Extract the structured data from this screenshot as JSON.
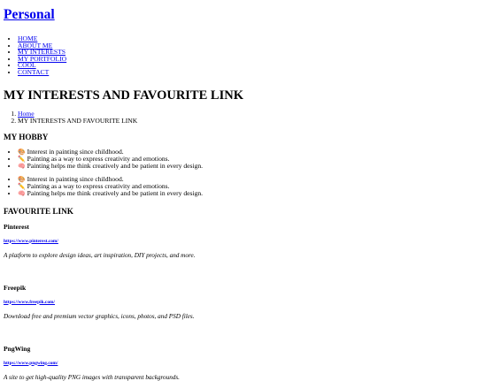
{
  "site": {
    "title": "Personal"
  },
  "nav": {
    "items": [
      "HOME",
      "ABOUT ME",
      "MY INTERESTS",
      "MY PORTFOLIO",
      "COOL",
      "CONTACT"
    ]
  },
  "page": {
    "title": "MY INTERESTS AND FAVOURITE LINK"
  },
  "breadcrumb": {
    "items": [
      "Home",
      "MY INTERESTS AND FAVOURITE LINK"
    ]
  },
  "hobby": {
    "title": "MY HOBBY",
    "list1": [
      {
        "icon": "🎨",
        "text": "Interest in painting since childhood."
      },
      {
        "icon": "✏️",
        "text": "Painting as a way to express creativity and emotions."
      },
      {
        "icon": "🧠",
        "text": "Painting helps me think creatively and be patient in every design."
      }
    ],
    "list2": [
      {
        "icon": "🎨",
        "text": "Interest in painting since childhood."
      },
      {
        "icon": "✏️",
        "text": "Painting as a way to express creativity and emotions."
      },
      {
        "icon": "🧠",
        "text": "Painting helps me think creatively and be patient in every design."
      }
    ]
  },
  "favourite": {
    "title": "FAVOURITE LINK",
    "links": [
      {
        "name": "Pinterest",
        "url": "https://www.pinterest.com/",
        "description": "A platform to explore design ideas, art inspiration, DIY projects, and more."
      },
      {
        "name": "Freepik",
        "url": "https://www.freepik.com/",
        "description": "Download free and premium vector graphics, icons, photos, and PSD files."
      },
      {
        "name": "PngWing",
        "url": "https://www.pngwing.com/",
        "description": "A site to get high-quality PNG images with transparent backgrounds."
      }
    ]
  },
  "colors": {
    "link": "#0000ee",
    "text": "#000000",
    "background": "#ffffff"
  }
}
